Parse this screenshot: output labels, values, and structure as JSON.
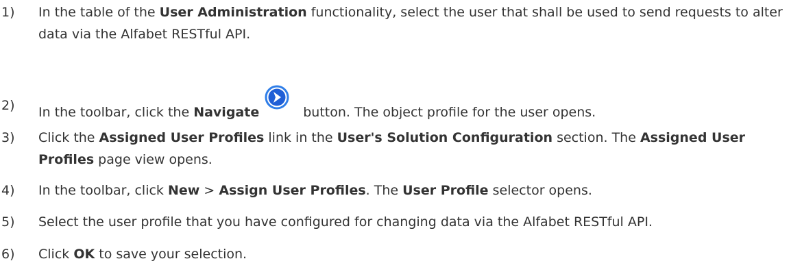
{
  "steps": [
    {
      "number": "1)",
      "parts": [
        "In the table of the ",
        "User Administration",
        " functionality, select the user that shall be used to send requests to alter data via the Alfabet RESTful API."
      ]
    },
    {
      "number": "2)",
      "parts": [
        "In the toolbar, click the ",
        "Navigate",
        "button. The object profile for the user opens."
      ],
      "icon": "navigate-arrow-icon"
    },
    {
      "number": "3)",
      "parts": [
        "Click the ",
        "Assigned User Profiles",
        " link in the ",
        "User's Solution Configuration",
        " section. The ",
        "Assigned User Profiles",
        " page view opens."
      ]
    },
    {
      "number": "4)",
      "parts": [
        "In the toolbar, click ",
        "New",
        " > ",
        "Assign User Profiles",
        ". The ",
        "User Profile",
        " selector opens."
      ]
    },
    {
      "number": "5)",
      "parts": [
        "Select the user profile that you have configured for changing data via the Alfabet RESTful API."
      ]
    },
    {
      "number": "6)",
      "parts": [
        "Click ",
        "OK",
        " to save your selection."
      ]
    }
  ],
  "colors": {
    "text": "#333333",
    "icon_blue": "#1f5fd6",
    "icon_ring": "#2f7ee8"
  }
}
